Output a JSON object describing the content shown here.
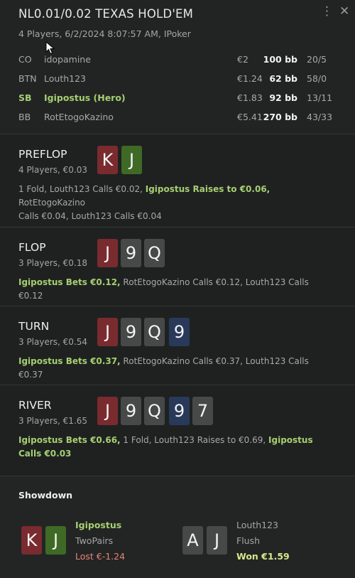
{
  "header": {
    "title": "NL0.01/0.02 TEXAS HOLD'EM",
    "subtitle": "4 Players, 6/2/2024 8:07:57 AM, IPoker",
    "icons": [
      "more-vertical-icon",
      "close-icon"
    ]
  },
  "players": [
    {
      "pos": "CO",
      "name": "idopamine",
      "money": "€2",
      "bb": "100 bb",
      "stat": "20/5",
      "hero": false
    },
    {
      "pos": "BTN",
      "name": "Louth123",
      "money": "€1.24",
      "bb": "62 bb",
      "stat": "58/0",
      "hero": false
    },
    {
      "pos": "SB",
      "name": "Igipostus (Hero)",
      "money": "€1.83",
      "bb": "92 bb",
      "stat": "13/11",
      "hero": true
    },
    {
      "pos": "BB",
      "name": "RotEtogoKazino",
      "money": "€5.41",
      "bb": "270 bb",
      "stat": "43/33",
      "hero": false
    }
  ],
  "streets": {
    "preflop": {
      "name": "PREFLOP",
      "info": "4 Players, €0.03",
      "cards": [
        "K",
        "J"
      ],
      "a1": "1 Fold, Louth123 Calls €0.02, ",
      "a2": "Igipostus Raises to €0.06,",
      "a3": " RotEtogoKazino",
      "a4": "Calls €0.04, Louth123 Calls €0.04"
    },
    "flop": {
      "name": "FLOP",
      "info": "3 Players, €0.18",
      "cards": [
        "J",
        "9",
        "Q"
      ],
      "a1": "Igipostus Bets €0.12,",
      "a2": " RotEtogoKazino Calls €0.12, Louth123 Calls €0.12"
    },
    "turn": {
      "name": "TURN",
      "info": "3 Players, €0.54",
      "cards": [
        "J",
        "9",
        "Q",
        "9"
      ],
      "a1": "Igipostus Bets €0.37,",
      "a2": " RotEtogoKazino Calls €0.37, Louth123 Calls €0.37"
    },
    "river": {
      "name": "RIVER",
      "info": "3 Players, €1.65",
      "cards": [
        "J",
        "9",
        "Q",
        "9",
        "7"
      ],
      "a1": "Igipostus Bets €0.66,",
      "a2": " 1 Fold, Louth123 Raises to €0.69, ",
      "a3": "Igipostus",
      "a4": "Calls €0.03"
    }
  },
  "showdown": {
    "title": "Showdown",
    "hero": {
      "cards": [
        "K",
        "J"
      ],
      "name": "Igipostus",
      "hand": "TwoPairs",
      "result": "Lost €-1.24"
    },
    "villain": {
      "cards": [
        "A",
        "J"
      ],
      "name": "Louth123",
      "hand": "Flush",
      "result": "Won €1.59"
    }
  },
  "colors": {
    "background": "#1f2120",
    "hero_green": "#a6cf72",
    "card_red": "#7a2b2f",
    "card_green": "#3f6a25",
    "card_gray": "#474948",
    "card_blue": "#29395a",
    "lost": "#e3847a",
    "won": "#d6e88a"
  }
}
